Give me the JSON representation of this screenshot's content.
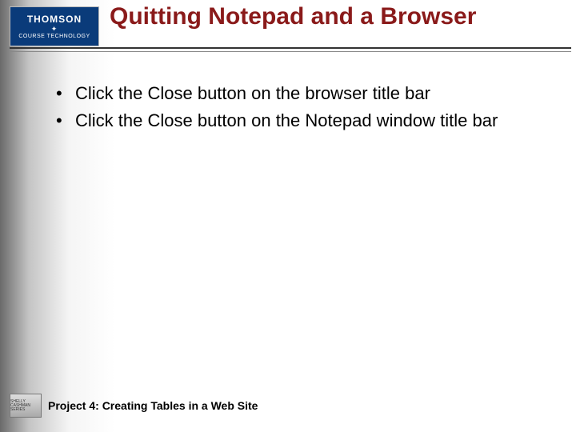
{
  "logo": {
    "top": "THOMSON",
    "bottom": "COURSE TECHNOLOGY"
  },
  "title": "Quitting Notepad and a Browser",
  "bullets": [
    "Click the Close button on the browser title bar",
    "Click the Close button on the Notepad window title bar"
  ],
  "footer": {
    "series": "SHELLY CASHMAN SERIES",
    "text": "Project 4: Creating Tables in a Web Site"
  }
}
